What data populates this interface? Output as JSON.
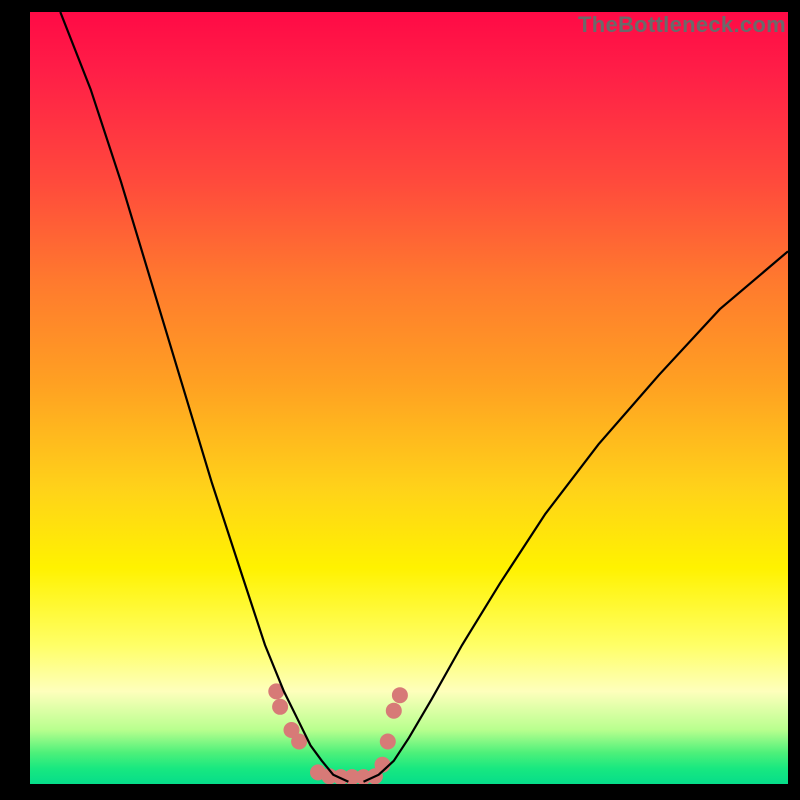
{
  "watermark": "TheBottleneck.com",
  "chart_data": {
    "type": "line",
    "title": "",
    "xlabel": "",
    "ylabel": "",
    "xlim": [
      0,
      100
    ],
    "ylim": [
      0,
      100
    ],
    "grid": false,
    "legend": false,
    "background_gradient": {
      "stops": [
        {
          "pos": 0.0,
          "color": "#ff0a46"
        },
        {
          "pos": 0.35,
          "color": "#ff7a2e"
        },
        {
          "pos": 0.62,
          "color": "#ffd319"
        },
        {
          "pos": 0.82,
          "color": "#ffff66"
        },
        {
          "pos": 0.93,
          "color": "#b8ff8e"
        },
        {
          "pos": 1.0,
          "color": "#06dd8a"
        }
      ]
    },
    "series": [
      {
        "name": "left-curve",
        "stroke": "#000000",
        "x": [
          4,
          8,
          12,
          16,
          20,
          24,
          28,
          31,
          33.5,
          35.5,
          37,
          38.5,
          40,
          42
        ],
        "y": [
          100,
          90,
          78,
          65,
          52,
          39,
          27,
          18,
          12,
          8,
          5,
          3,
          1.2,
          0.3
        ]
      },
      {
        "name": "right-curve",
        "stroke": "#000000",
        "x": [
          44,
          46,
          48,
          50,
          53,
          57,
          62,
          68,
          75,
          83,
          91,
          100
        ],
        "y": [
          0.3,
          1.2,
          3,
          6,
          11,
          18,
          26,
          35,
          44,
          53,
          61.5,
          69
        ]
      },
      {
        "name": "valley-scatter",
        "type": "scatter",
        "color": "#d77a77",
        "x": [
          32.5,
          33,
          34.5,
          35.5,
          38,
          39.5,
          41,
          42.5,
          44,
          45.5,
          46.5,
          47.2,
          48.0,
          48.8
        ],
        "y": [
          12,
          10,
          7,
          5.5,
          1.5,
          1.0,
          0.9,
          0.9,
          0.9,
          1.0,
          2.5,
          5.5,
          9.5,
          11.5
        ]
      }
    ]
  }
}
